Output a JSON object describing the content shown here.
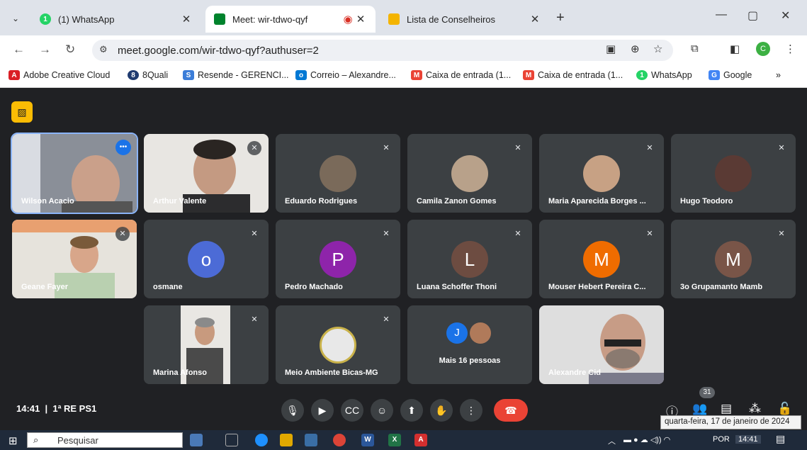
{
  "browser": {
    "tabs": [
      {
        "title": "(1) WhatsApp",
        "favicon_color": "#25d366",
        "active": false
      },
      {
        "title": "Meet: wir-tdwo-qyf",
        "favicon_color": "#00832d",
        "active": true
      },
      {
        "title": "Lista de Conselheiros",
        "favicon_color": "#f4b400",
        "active": false
      }
    ],
    "url": "meet.google.com/wir-tdwo-qyf?authuser=2",
    "profile_initial": "C",
    "bookmarks": [
      {
        "label": "Adobe Creative Cloud",
        "color": "#da1f26"
      },
      {
        "label": "8Quali",
        "color": "#1f3b70"
      },
      {
        "label": "Resende - GERENCI...",
        "color": "#3b7dd8"
      },
      {
        "label": "Correio – Alexandre...",
        "color": "#0078d4"
      },
      {
        "label": "Caixa de entrada (1...",
        "color": "#ea4335"
      },
      {
        "label": "Caixa de entrada (1...",
        "color": "#ea4335"
      },
      {
        "label": "WhatsApp",
        "color": "#25d366"
      },
      {
        "label": "Google",
        "color": "#4285f4"
      }
    ]
  },
  "meet": {
    "participants": [
      {
        "name": "Wilson Acacio",
        "kind": "video",
        "speaking": true
      },
      {
        "name": "Arthur Valente",
        "kind": "video",
        "muted": true
      },
      {
        "name": "Eduardo Rodrigues",
        "kind": "photo",
        "muted": true,
        "photo_color": "#7a6a5a"
      },
      {
        "name": "Camila Zanon Gomes",
        "kind": "photo",
        "muted": true,
        "photo_color": "#b8a18a"
      },
      {
        "name": "Maria Aparecida Borges ...",
        "kind": "photo",
        "muted": true,
        "photo_color": "#c7a184"
      },
      {
        "name": "Hugo Teodoro",
        "kind": "photo",
        "muted": true,
        "photo_color": "#5a3a34"
      },
      {
        "name": "Geane Fayer",
        "kind": "video",
        "muted": true
      },
      {
        "name": "osmane",
        "kind": "letter",
        "letter": "o",
        "muted": true,
        "avatar_color": "#4c6bd6"
      },
      {
        "name": "Pedro Machado",
        "kind": "letter",
        "letter": "P",
        "muted": true,
        "avatar_color": "#8e24aa"
      },
      {
        "name": "Luana Schoffer Thoni",
        "kind": "letter",
        "letter": "L",
        "muted": true,
        "avatar_color": "#6d4c41"
      },
      {
        "name": "Mouser Hebert Pereira C...",
        "kind": "letter",
        "letter": "M",
        "muted": true,
        "avatar_color": "#ef6c00"
      },
      {
        "name": "3o Grupamanto Mamb",
        "kind": "letter",
        "letter": "M",
        "muted": true,
        "avatar_color": "#795548"
      },
      {
        "name": "Marina Afonso",
        "kind": "video",
        "muted": true
      },
      {
        "name": "Meio Ambiente Bicas-MG",
        "kind": "photo",
        "muted": true,
        "photo_color": "#e8e8e8"
      },
      {
        "name": "Mais 16 pessoas",
        "kind": "more",
        "letter": "J"
      },
      {
        "name": "Alexandre Cid",
        "kind": "video"
      }
    ],
    "clock": "14:41",
    "meeting_name": "1ª RE PS1",
    "people_count": "31"
  },
  "taskbar": {
    "search_placeholder": "Pesquisar",
    "language": "POR",
    "time": "14:41",
    "date_tooltip": "quarta-feira, 17 de janeiro de 2024"
  }
}
